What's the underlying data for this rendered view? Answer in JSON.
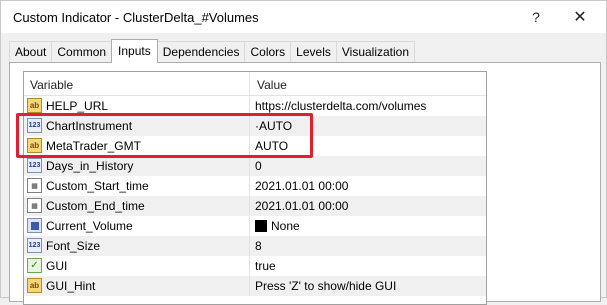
{
  "window": {
    "title": "Custom Indicator - ClusterDelta_#Volumes",
    "help_label": "?",
    "close_label": "✕"
  },
  "tabs": [
    {
      "label": "About"
    },
    {
      "label": "Common"
    },
    {
      "label": "Inputs"
    },
    {
      "label": "Dependencies"
    },
    {
      "label": "Colors"
    },
    {
      "label": "Levels"
    },
    {
      "label": "Visualization"
    }
  ],
  "active_tab": "Inputs",
  "grid": {
    "headers": {
      "variable": "Variable",
      "value": "Value"
    },
    "rows": [
      {
        "icon": "ab",
        "icon_text": "ab",
        "name": "HELP_URL",
        "value": "https://clusterdelta.com/volumes"
      },
      {
        "icon": "num",
        "icon_text": "123",
        "name": "ChartInstrument",
        "value": "·AUTO"
      },
      {
        "icon": "ab",
        "icon_text": "ab",
        "name": "MetaTrader_GMT",
        "value": "AUTO"
      },
      {
        "icon": "num",
        "icon_text": "123",
        "name": "Days_in_History",
        "value": "0"
      },
      {
        "icon": "dt",
        "icon_text": "▦",
        "name": "Custom_Start_time",
        "value": "2021.01.01 00:00"
      },
      {
        "icon": "dt",
        "icon_text": "▦",
        "name": "Custom_End_time",
        "value": "2021.01.01 00:00"
      },
      {
        "icon": "clr",
        "icon_text": "",
        "name": "Current_Volume",
        "value": "None",
        "swatch": "#000000"
      },
      {
        "icon": "num",
        "icon_text": "123",
        "name": "Font_Size",
        "value": "8"
      },
      {
        "icon": "bool",
        "icon_text": "✓",
        "name": "GUI",
        "value": "true"
      },
      {
        "icon": "ab",
        "icon_text": "ab",
        "name": "GUI_Hint",
        "value": "Press 'Z' to show/hide GUI"
      }
    ]
  },
  "colors": {
    "highlight": "#e02030",
    "accent_border": "#adadad"
  }
}
